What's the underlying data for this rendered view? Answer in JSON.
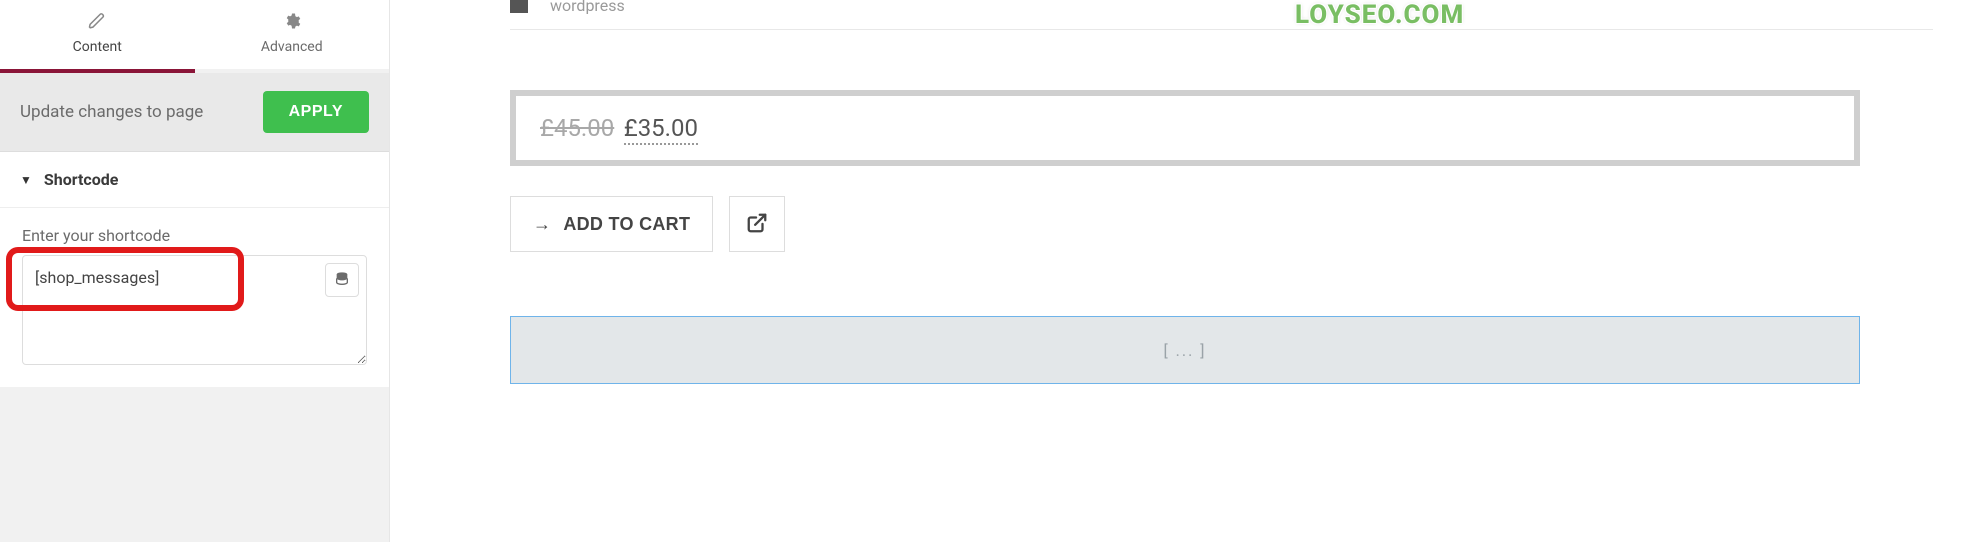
{
  "watermark": "LOYSEO.COM",
  "sidebar": {
    "tabs": {
      "content": "Content",
      "advanced": "Advanced",
      "active": "content"
    },
    "update": {
      "text": "Update changes to page",
      "apply": "APPLY"
    },
    "section": {
      "title": "Shortcode"
    },
    "field": {
      "label": "Enter your shortcode",
      "value": "[shop_messages]"
    }
  },
  "preview": {
    "crumb": "wordpress",
    "price": {
      "old": "£45.00",
      "new": "£35.00"
    },
    "buttons": {
      "add_to_cart": "ADD TO CART"
    },
    "placeholder": "[ ... ]"
  }
}
